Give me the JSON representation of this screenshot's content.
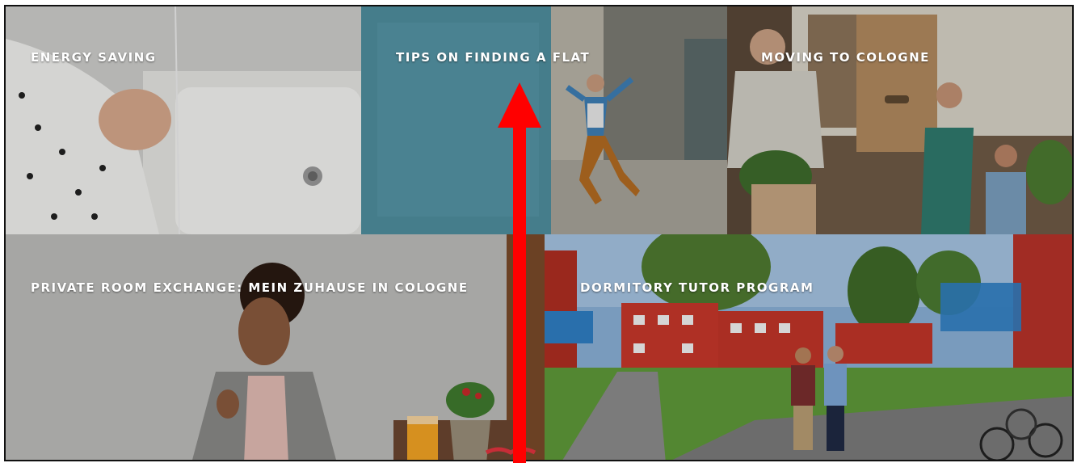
{
  "tiles": [
    {
      "label": "ENERGY SAVING"
    },
    {
      "label": "TIPS ON FINDING A FLAT"
    },
    {
      "label": "MOVING TO COLOGNE"
    },
    {
      "label": "PRIVATE ROOM EXCHANGE: MEIN ZUHAUSE IN COLOGNE"
    },
    {
      "label": "DORMITORY TUTOR PROGRAM"
    }
  ],
  "annotation": {
    "color": "#ff0000",
    "icon": "arrow-up-icon"
  }
}
